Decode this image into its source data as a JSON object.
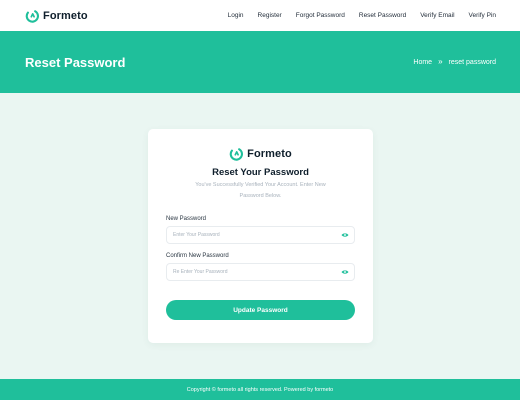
{
  "brand": {
    "name": "Formeto",
    "logo_icon": "formeto-logo-icon",
    "accent_color": "#1fbf9b"
  },
  "nav": {
    "items": [
      {
        "label": "Login"
      },
      {
        "label": "Register"
      },
      {
        "label": "Forgot Password"
      },
      {
        "label": "Reset Password"
      },
      {
        "label": "Verify Email"
      },
      {
        "label": "Verify Pin"
      }
    ]
  },
  "hero": {
    "title": "Reset Password",
    "breadcrumb": {
      "home": "Home",
      "separator": "»",
      "current": "reset password"
    }
  },
  "card": {
    "brand_name": "Formeto",
    "title": "Reset Your Password",
    "subtitle": "You've Successfully Verified Your Account. Enter New Password Below.",
    "new_password": {
      "label": "New Password",
      "placeholder": "Enter Your Password",
      "value": "",
      "icon": "eye-icon"
    },
    "confirm_password": {
      "label": "Confirm New Password",
      "placeholder": "Re Enter Your Password",
      "value": "",
      "icon": "eye-icon"
    },
    "submit_label": "Update Password"
  },
  "footer": {
    "text": "Copyright © formeto all rights reserved. Powered by formeto"
  }
}
